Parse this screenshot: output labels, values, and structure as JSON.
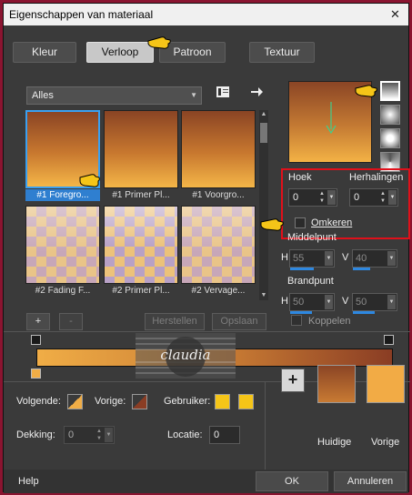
{
  "window": {
    "title": "Eigenschappen van materiaal",
    "close_symbol": "✕"
  },
  "tabs": [
    {
      "label": "Kleur",
      "active": false
    },
    {
      "label": "Verloop",
      "active": true
    },
    {
      "label": "Patroon",
      "active": false
    },
    {
      "label": "Textuur",
      "active": false
    }
  ],
  "library": {
    "category_value": "Alles",
    "thumbnails": [
      {
        "label": "#1 Foregro...",
        "selected": true
      },
      {
        "label": "#1 Primer Pl...",
        "selected": false
      },
      {
        "label": "#1 Voorgro...",
        "selected": false
      },
      {
        "label": "#2 Fading F...",
        "selected": false
      },
      {
        "label": "#2 Primer Pl...",
        "selected": false
      },
      {
        "label": "#2 Vervage...",
        "selected": false
      }
    ]
  },
  "list_buttons": {
    "add": "+",
    "remove": "-",
    "reset": "Herstellen",
    "save": "Opslaan"
  },
  "settings": {
    "angle_label": "Hoek",
    "angle_value": "0",
    "repeats_label": "Herhalingen",
    "repeats_value": "0",
    "invert_label": "Omkeren",
    "invert_checked": false,
    "midpoint_label": "Middelpunt",
    "mid_h_label": "H",
    "mid_h_value": "55",
    "mid_v_label": "V",
    "mid_v_value": "40",
    "focal_label": "Brandpunt",
    "focal_h_label": "H",
    "focal_h_value": "50",
    "focal_v_label": "V",
    "focal_v_value": "50",
    "link_label": "Koppelen",
    "link_checked": false
  },
  "editor": {
    "next_label": "Volgende:",
    "prev_label": "Vorige:",
    "user_label": "Gebruiker:",
    "opacity_label": "Dekking:",
    "opacity_value": "0",
    "location_label": "Locatie:",
    "location_value": "0"
  },
  "colors": {
    "current_label": "Huidige",
    "previous_label": "Vorige",
    "current_color": "#8b4525",
    "previous_color": "#f2ab45",
    "accent": "#3aa0f0",
    "highlight_box": "#e0101a"
  },
  "footer": {
    "help": "Help",
    "ok": "OK",
    "cancel": "Annuleren"
  },
  "watermark_text": "claudia"
}
